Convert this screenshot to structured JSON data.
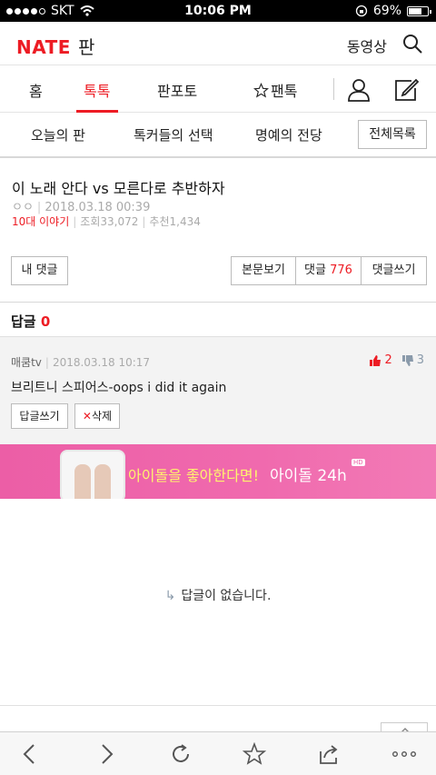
{
  "status": {
    "carrier": "SKT",
    "time": "10:06 PM",
    "battery": "69%"
  },
  "header": {
    "logo": "NATE",
    "section": "판",
    "video_label": "동영상"
  },
  "tabs": [
    {
      "label": "홈"
    },
    {
      "label": "톡톡"
    },
    {
      "label": "판포토"
    },
    {
      "label": "팬톡"
    }
  ],
  "subnav": {
    "items": [
      "오늘의 판",
      "톡커들의 선택",
      "명예의 전당"
    ],
    "all_label": "전체목록"
  },
  "post": {
    "title": "이 노래 안다 vs 모른다로 추반하자",
    "author": "ㅇㅇ",
    "date": "2018.03.18 00:39",
    "category": "10대 이야기",
    "views": "조회33,072",
    "recommend": "추천1,434"
  },
  "buttons": {
    "my_comment": "내 댓글",
    "view_body": "본문보기",
    "comments_label": "댓글",
    "comments_count": "776",
    "write_comment": "댓글쓰기"
  },
  "replies": {
    "label": "답글",
    "count": "0"
  },
  "comment": {
    "author": "매쿰tv",
    "date": "2018.03.18 10:17",
    "text": "브리트니 스피어스-oops i did it again",
    "up": "2",
    "down": "3",
    "reply_btn": "답글쓰기",
    "delete_btn": "삭제"
  },
  "banner": {
    "text1": "아이돌을 좋아한다면!",
    "text2": "아이돌 24h",
    "badge": "HD"
  },
  "empty_message": "답글이 없습니다.",
  "colors": {
    "accent": "#ed1c24",
    "banner": "#ec5ea6"
  }
}
